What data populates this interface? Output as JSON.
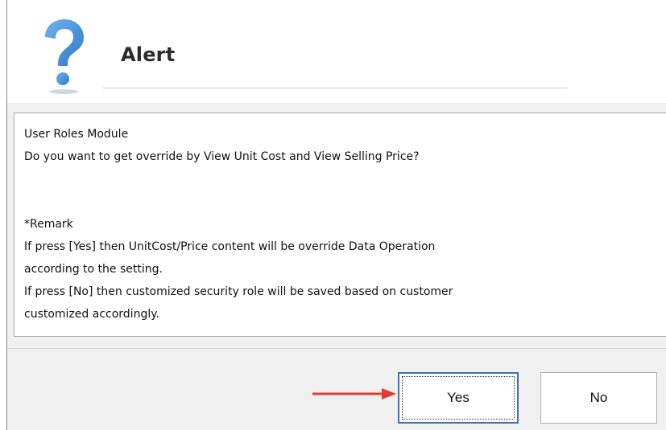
{
  "dialog": {
    "title": "Alert",
    "icon": "question-mark-icon",
    "message": {
      "module": "User Roles Module",
      "question": "Do you want to get override by View Unit Cost and View Selling Price?",
      "remark_heading": "*Remark",
      "remark_lines": [
        "If press [Yes] then UnitCost/Price content will be override Data Operation",
        "according to the setting.",
        "If press [No] then customized security role will be saved based on customer",
        "customized accordingly."
      ]
    },
    "buttons": {
      "yes": "Yes",
      "no": "No"
    }
  },
  "annotation": {
    "arrow_color": "#e03c31",
    "points_to": "yes"
  },
  "colors": {
    "icon_blue": "#3f8bd8",
    "focus_border": "#3c6fb5",
    "panel_bg": "#f0f0f0"
  }
}
